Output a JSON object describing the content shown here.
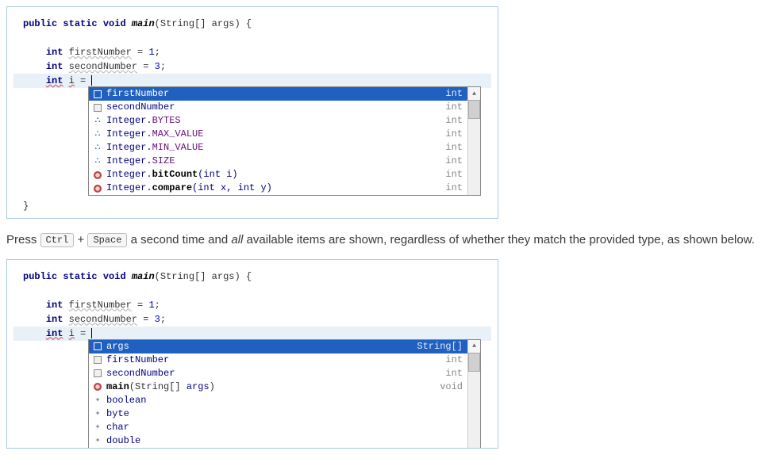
{
  "code1": {
    "l1_kw1": "public",
    "l1_kw2": "static",
    "l1_kw3": "void",
    "l1_fname": "main",
    "l1_rest": "(String[] args) {",
    "l3_type": "int",
    "l3_var": "firstNumber",
    "l3_rest": " = ",
    "l3_num": "1",
    "l3_semi": ";",
    "l4_type": "int",
    "l4_var": "secondNumber",
    "l4_rest": " = ",
    "l4_num": "3",
    "l4_semi": ";",
    "l5_type": "int",
    "l5_var": "i",
    "l5_rest": " = ",
    "l7_brace": "}"
  },
  "popup1": {
    "items": [
      {
        "icon": "field",
        "label": "firstNumber",
        "hint": "int",
        "selected": true
      },
      {
        "icon": "field",
        "label": "secondNumber",
        "hint": "int"
      },
      {
        "icon": "lib",
        "label": "Integer.",
        "suffix": "BYTES",
        "hint": "int"
      },
      {
        "icon": "lib",
        "label": "Integer.",
        "suffix": "MAX_VALUE",
        "hint": "int"
      },
      {
        "icon": "lib",
        "label": "Integer.",
        "suffix": "MIN_VALUE",
        "hint": "int"
      },
      {
        "icon": "lib",
        "label": "Integer.",
        "suffix": "SIZE",
        "hint": "int"
      },
      {
        "icon": "method",
        "prefix": "Integer.",
        "method": "bitCount",
        "params": "(int i)",
        "hint": "int"
      },
      {
        "icon": "method",
        "prefix": "Integer.",
        "method": "compare",
        "params": "(int x, int y)",
        "hint": "int"
      }
    ]
  },
  "instruction": {
    "pre": "Press ",
    "key1": "Ctrl",
    "plus": " + ",
    "key2": "Space",
    "mid": " a second time and ",
    "em": "all",
    "post": " available items are shown, regardless of whether they match the provided type, as shown below."
  },
  "popup2": {
    "items": [
      {
        "icon": "field",
        "label": "args",
        "hint": "String[]",
        "selected": true
      },
      {
        "icon": "field",
        "label": "firstNumber",
        "hint": "int"
      },
      {
        "icon": "field",
        "label": "secondNumber",
        "hint": "int"
      },
      {
        "icon": "method",
        "method": "main",
        "params_pre": "(String[] ",
        "params_var": "args",
        "params_post": ")",
        "hint": "void"
      },
      {
        "icon": "keyword",
        "label": "boolean"
      },
      {
        "icon": "keyword",
        "label": "byte"
      },
      {
        "icon": "keyword",
        "label": "char"
      },
      {
        "icon": "keyword",
        "label": "double"
      }
    ]
  }
}
